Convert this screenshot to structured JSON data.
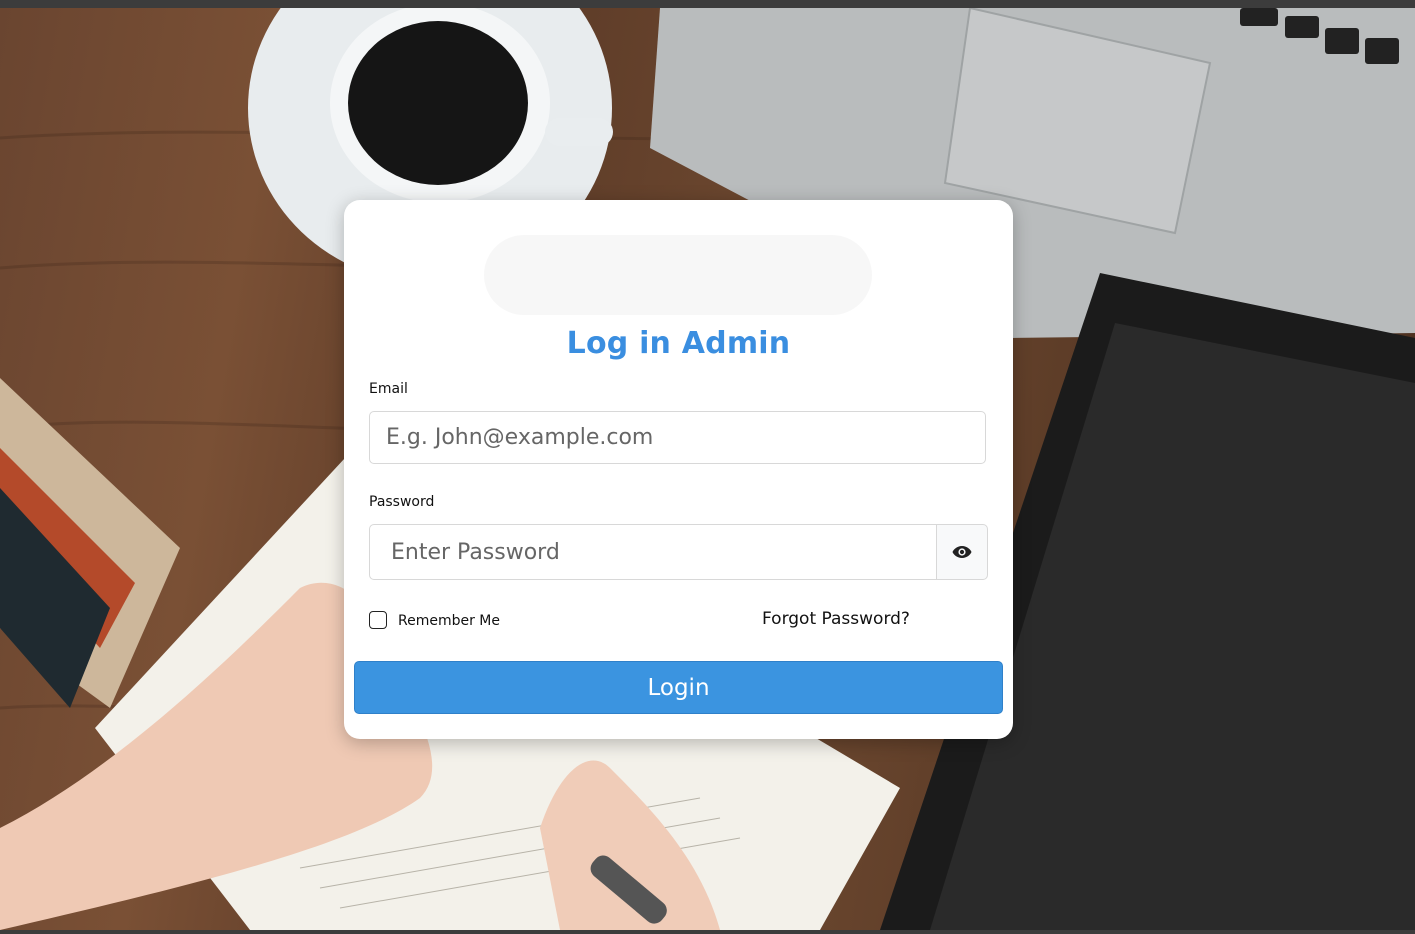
{
  "login": {
    "title": "Log in Admin",
    "email_label": "Email",
    "email_placeholder": "E.g. John@example.com",
    "password_label": "Password",
    "password_placeholder": "Enter Password",
    "password_toggle_icon": "eye-icon",
    "remember_label": "Remember Me",
    "remember_checked": false,
    "forgot_label": "Forgot Password?",
    "submit_label": "Login"
  },
  "colors": {
    "accent": "#3b94e0",
    "title": "#3a8ee0",
    "card_background": "#ffffff",
    "logo_placeholder": "#f7f7f7"
  }
}
